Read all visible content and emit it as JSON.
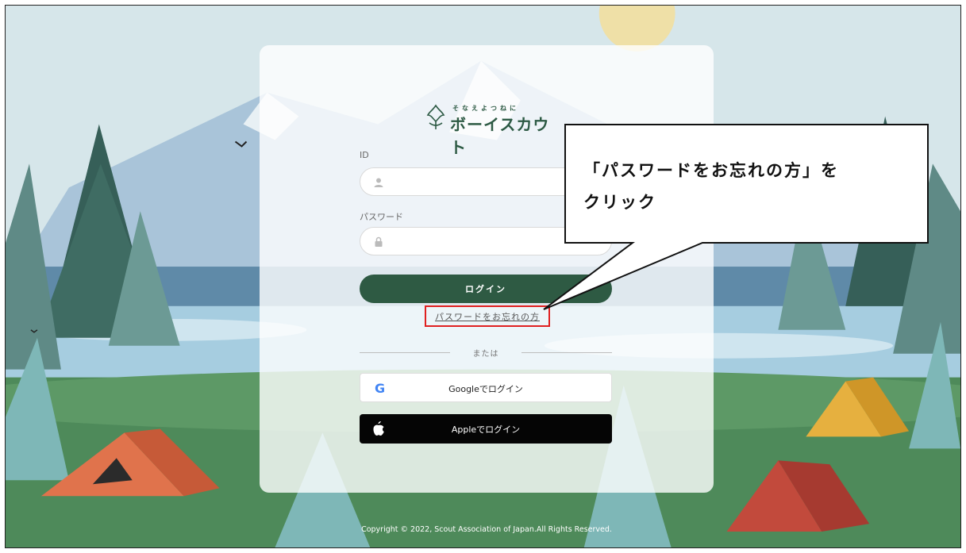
{
  "logo": {
    "kana": "そなえよつねに",
    "name": "ボーイスカウト"
  },
  "form": {
    "id_label": "ID",
    "password_label": "パスワード",
    "login_button": "ログイン",
    "forgot_password": "パスワードをお忘れの方",
    "divider_text": "または",
    "google_button": "Googleでログイン",
    "apple_button": "Appleでログイン"
  },
  "footer": {
    "copyright": "Copyright © 2022, Scout Association of Japan.All Rights Reserved."
  },
  "callout": {
    "line1": "「パスワードをお忘れの方」を",
    "line2": "クリック"
  },
  "colors": {
    "primary_green": "#2e5a43",
    "highlight_red": "#e02020",
    "apple_black": "#050505"
  },
  "icons": [
    "user-icon",
    "lock-icon",
    "google-icon",
    "apple-icon",
    "scout-emblem-icon"
  ]
}
